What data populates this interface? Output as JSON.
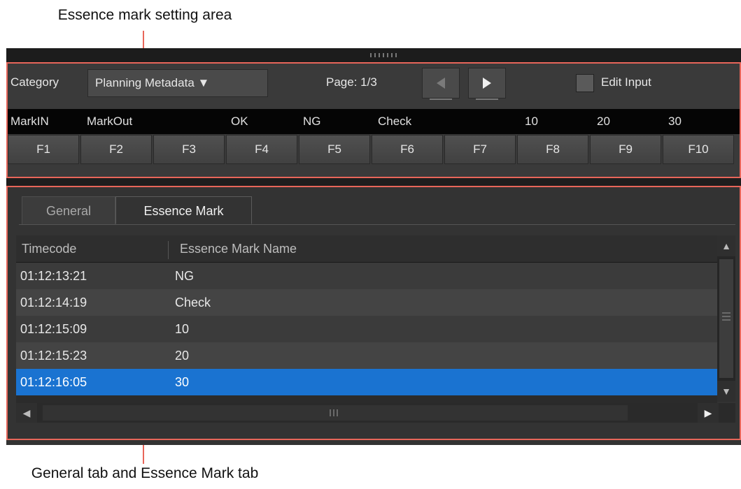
{
  "callouts": {
    "top": "Essence mark setting area",
    "bottom": "General tab and Essence Mark tab"
  },
  "settings": {
    "category_label": "Category",
    "category_value": "Planning Metadata ▼",
    "page_label": "Page: 1/3",
    "prev_icon": "triangle-left-icon",
    "next_icon": "triangle-right-icon",
    "edit_input_label": "Edit Input",
    "edit_input_checked": false,
    "mark_labels": [
      "MarkIN",
      "MarkOut",
      "",
      "OK",
      "NG",
      "Check",
      "",
      "10",
      "20",
      "30"
    ],
    "fkeys": [
      "F1",
      "F2",
      "F3",
      "F4",
      "F5",
      "F6",
      "F7",
      "F8",
      "F9",
      "F10"
    ]
  },
  "tabs": {
    "general": "General",
    "essence_mark": "Essence Mark",
    "active": "essence_mark"
  },
  "table": {
    "columns": [
      "Timecode",
      "Essence Mark Name"
    ],
    "rows": [
      {
        "timecode": "01:12:13:21",
        "name": "NG",
        "selected": false
      },
      {
        "timecode": "01:12:14:19",
        "name": "Check",
        "selected": false
      },
      {
        "timecode": "01:12:15:09",
        "name": "10",
        "selected": false
      },
      {
        "timecode": "01:12:15:23",
        "name": "20",
        "selected": false
      },
      {
        "timecode": "01:12:16:05",
        "name": "30",
        "selected": true
      }
    ]
  },
  "colors": {
    "highlight": "#e8665a",
    "selection": "#1a73d1"
  }
}
